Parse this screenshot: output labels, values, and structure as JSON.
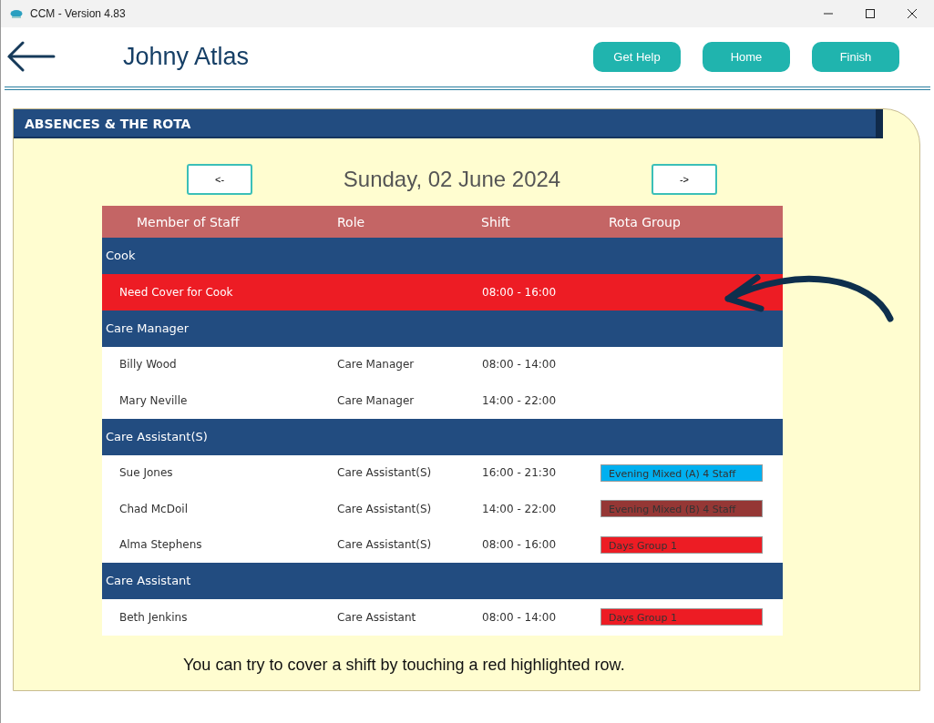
{
  "window": {
    "title": "CCM - Version 4.83"
  },
  "header": {
    "name": "Johny Atlas",
    "buttons": [
      "Get Help",
      "Home",
      "Finish"
    ]
  },
  "panel": {
    "title": "ABSENCES & THE ROTA",
    "prev": "<-",
    "next": "->",
    "date": "Sunday, 02 June 2024"
  },
  "table": {
    "columns": [
      "Member of Staff",
      "Role",
      "Shift",
      "Rota Group"
    ],
    "groups": [
      {
        "name": "Cook",
        "rows": [
          {
            "name": "Need Cover for Cook",
            "shift": "08:00 - 16:00",
            "alert": true
          }
        ]
      },
      {
        "name": "Care Manager",
        "rows": [
          {
            "name": "Billy Wood",
            "role": "Care Manager",
            "shift": "08:00 - 14:00",
            "alert": false
          },
          {
            "name": "Mary Neville",
            "role": "Care Manager",
            "shift": "14:00 - 22:00",
            "alert": false
          }
        ]
      },
      {
        "name": "Care Assistant(S)",
        "rows": [
          {
            "name": "Sue Jones",
            "role": "Care Assistant(S)",
            "shift": "16:00 - 21:30",
            "alert": false,
            "rota_group": {
              "label": "Evening Mixed (A) 4 Staff",
              "color": "#00b0f0"
            }
          },
          {
            "name": "Chad McDoil",
            "role": "Care Assistant(S)",
            "shift": "14:00 - 22:00",
            "alert": false,
            "rota_group": {
              "label": "Evening Mixed (B) 4 Staff",
              "color": "#953735"
            }
          },
          {
            "name": "Alma Stephens",
            "role": "Care Assistant(S)",
            "shift": "08:00 - 16:00",
            "alert": false,
            "rota_group": {
              "label": "Days Group 1",
              "color": "#ed1c24"
            }
          }
        ]
      },
      {
        "name": "Care Assistant",
        "rows": [
          {
            "name": "Beth Jenkins",
            "role": "Care Assistant",
            "shift": "08:00 - 14:00",
            "alert": false,
            "rota_group": {
              "label": "Days Group 1",
              "color": "#ed1c24"
            }
          }
        ]
      }
    ]
  },
  "footer": "You can try to cover a shift by touching a red highlighted row."
}
